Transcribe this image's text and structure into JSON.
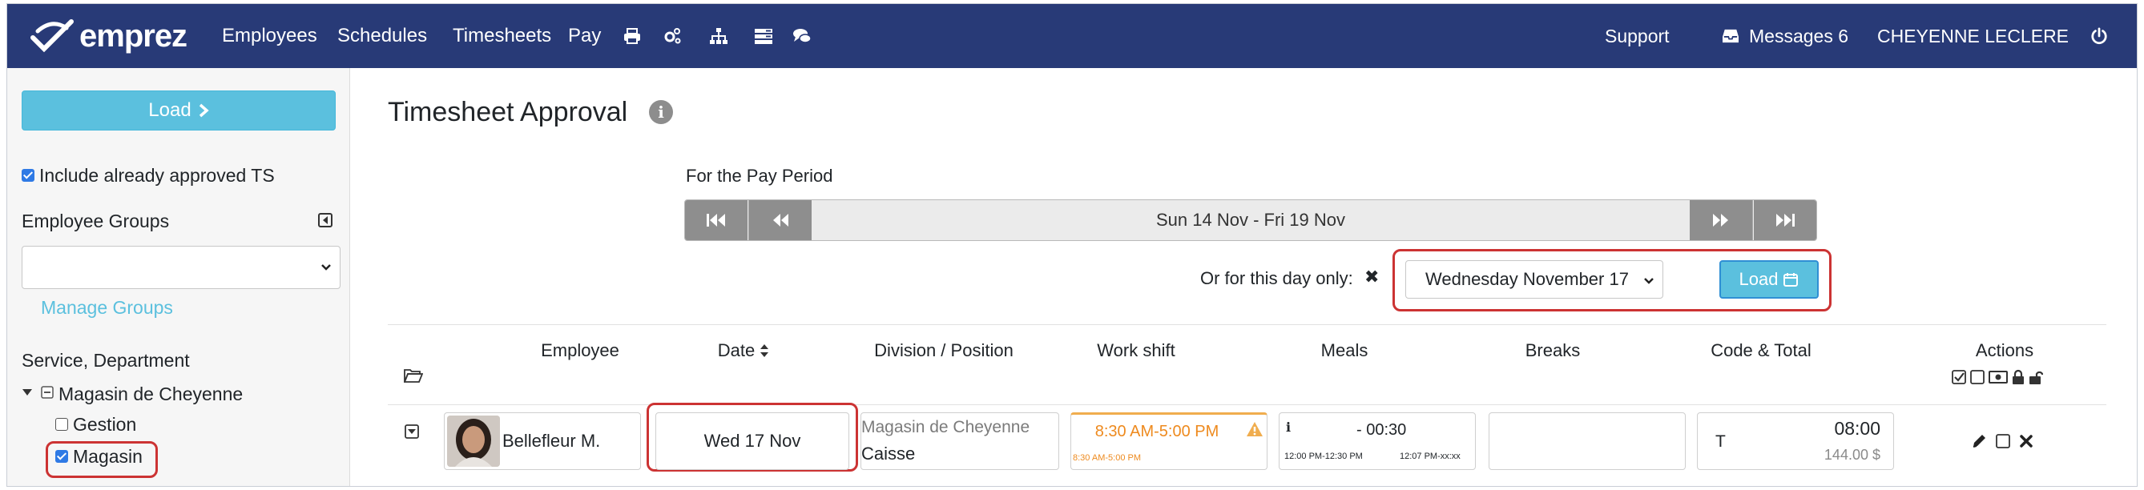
{
  "app": {
    "logo_text": "emprez",
    "colors": {
      "navbar": "#283a77",
      "accent": "#5bc0de",
      "highlight": "#cc3333",
      "warning": "#f0ad4e"
    }
  },
  "nav": {
    "items": [
      "Employees",
      "Schedules",
      "Timesheets",
      "Pay"
    ],
    "icons": [
      "print-icon",
      "cogs-icon",
      "sitemap-icon",
      "tasks-icon",
      "comments-icon"
    ],
    "support": "Support",
    "messages": "Messages 6",
    "user": "CHEYENNE LECLERE"
  },
  "sidebar": {
    "load_label": "Load",
    "include_approved": "Include already approved TS",
    "employee_groups": "Employee Groups",
    "manage_groups": "Manage Groups",
    "service_department": "Service, Department",
    "tree": {
      "root": "Magasin de Cheyenne",
      "children": [
        "Gestion",
        "Magasin"
      ]
    }
  },
  "main": {
    "title": "Timesheet Approval",
    "pay_period_label": "For the Pay Period",
    "period_text": "Sun 14 Nov - Fri 19 Nov",
    "day_only_label": "Or for this day only:",
    "day_select_value": "Wednesday November 17",
    "load_day_label": "Load",
    "columns": [
      "Employee",
      "Date",
      "Division / Position",
      "Work shift",
      "Meals",
      "Breaks",
      "Code & Total",
      "Actions"
    ]
  },
  "row": {
    "employee": "Bellefleur M.",
    "date": "Wed 17 Nov",
    "division": "Magasin de Cheyenne",
    "position": "Caisse",
    "shift": "8:30 AM-5:00 PM",
    "shift_small": "8:30 AM-5:00 PM",
    "meal_icon": "i",
    "meal_duration": "- 00:30",
    "meal_start": "12:00 PM-12:30 PM",
    "meal_end": "12:07 PM-xx:xx",
    "code": "T",
    "hours": "08:00",
    "amount": "144.00 $"
  }
}
